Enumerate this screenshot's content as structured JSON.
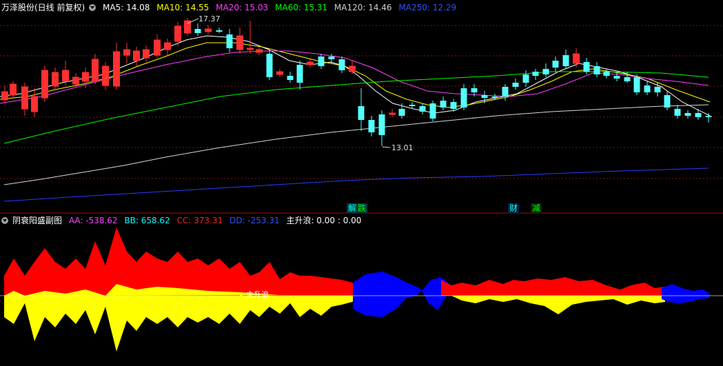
{
  "main_header": {
    "stock": "万泽股份(日线 前复权)",
    "ma": [
      {
        "label": "MA5: 14.08",
        "color": "#ffffff"
      },
      {
        "label": "MA10: 14.55",
        "color": "#ffff00"
      },
      {
        "label": "MA20: 15.03",
        "color": "#ff40ff"
      },
      {
        "label": "MA60: 15.31",
        "color": "#00ff00"
      },
      {
        "label": "MA120: 14.46",
        "color": "#d0d0d0"
      },
      {
        "label": "MA250: 12.29",
        "color": "#3050ff"
      }
    ]
  },
  "price_annotations": {
    "high": "17.37",
    "low": "13.01"
  },
  "event_tags": [
    {
      "text": "解",
      "color": "#00ffff"
    },
    {
      "text": "跌",
      "color": "#00ff00"
    },
    {
      "text": "财",
      "color": "#00ffff"
    },
    {
      "text": "减",
      "color": "#00ff00"
    }
  ],
  "sub_header": {
    "title": "阴衰阳盛副图",
    "values": [
      {
        "label": "AA: -538.62",
        "color": "#ff40ff"
      },
      {
        "label": "BB: 658.62",
        "color": "#00ffff"
      },
      {
        "label": "CC: 373.31",
        "color": "#ff2020"
      },
      {
        "label": "DD: -253.31",
        "color": "#3050ff"
      },
      {
        "label": "主升浪: 0.00 : 0.00",
        "color": "#ffffff"
      }
    ]
  },
  "sub_marker": "主升浪",
  "colors": {
    "up": "#ff3030",
    "down": "#54ffff",
    "red_area": "#ff0000",
    "yellow_area": "#ffff00",
    "blue_area": "#0000ff"
  }
}
